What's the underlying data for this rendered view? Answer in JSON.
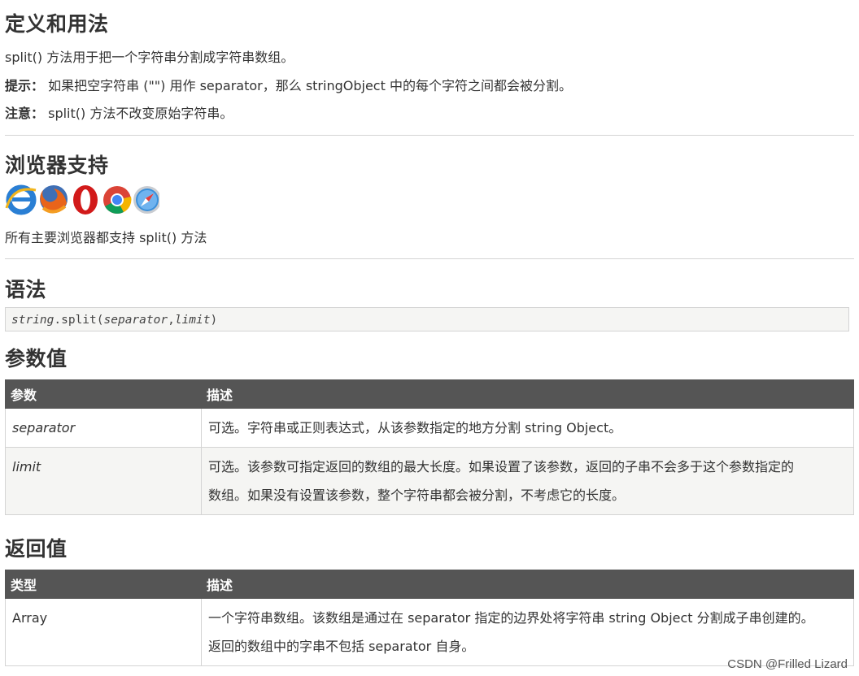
{
  "definition": {
    "title": "定义和用法",
    "desc": "split() 方法用于把一个字符串分割成字符串数组。",
    "tip_label": "提示：",
    "tip_text": "如果把空字符串 (\"\") 用作 separator，那么 stringObject 中的每个字符之间都会被分割。",
    "note_label": "注意：",
    "note_text": "split() 方法不改变原始字符串。"
  },
  "browser_support": {
    "title": "浏览器支持",
    "icons": [
      "internet-explorer-icon",
      "firefox-icon",
      "opera-icon",
      "chrome-icon",
      "safari-icon"
    ],
    "text": "所有主要浏览器都支持 split() 方法"
  },
  "syntax": {
    "title": "语法",
    "obj": "string",
    "method": ".split(",
    "arg1": "separator",
    "comma": ",",
    "arg2": "limit",
    "close": ")"
  },
  "params": {
    "title": "参数值",
    "headers": [
      "参数",
      "描述"
    ],
    "rows": [
      {
        "name": "separator",
        "desc": "可选。字符串或正则表达式，从该参数指定的地方分割 string Object。"
      },
      {
        "name": "limit",
        "desc_line1": "可选。该参数可指定返回的数组的最大长度。如果设置了该参数，返回的子串不会多于这个参数指定的",
        "desc_line2": "数组。如果没有设置该参数，整个字符串都会被分割，不考虑它的长度。"
      }
    ]
  },
  "return_value": {
    "title": "返回值",
    "headers": [
      "类型",
      "描述"
    ],
    "rows": [
      {
        "type": "Array",
        "desc_line1": "一个字符串数组。该数组是通过在 separator 指定的边界处将字符串 string Object 分割成子串创建的。",
        "desc_line2": "返回的数组中的字串不包括 separator 自身。"
      }
    ]
  },
  "watermark": "CSDN @Frilled Lizard"
}
